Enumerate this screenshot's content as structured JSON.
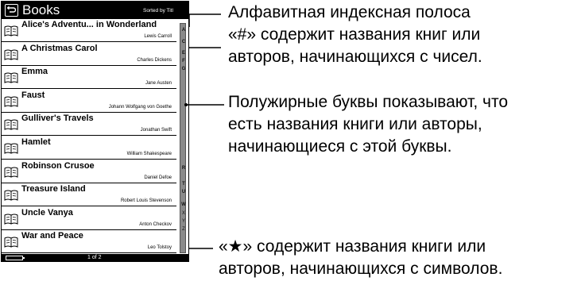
{
  "screen": {
    "header": {
      "title": "Books",
      "sort_label": "Sorted by Titl",
      "back_icon": "back-arrow-icon"
    },
    "books": [
      {
        "title": "Alice's Adventu... in Wonderland",
        "author": "Lewis Carroll"
      },
      {
        "title": "A Christmas Carol",
        "author": "Charles Dickens"
      },
      {
        "title": "Emma",
        "author": "Jane Austen"
      },
      {
        "title": "Faust",
        "author": "Johann Wolfgang von Goethe"
      },
      {
        "title": "Gulliver's Travels",
        "author": "Jonathan Swift"
      },
      {
        "title": "Hamlet",
        "author": "William Shakespeare"
      },
      {
        "title": "Robinson Crusoe",
        "author": "Daniel Defoe"
      },
      {
        "title": "Treasure Island",
        "author": "Robert Louis Stevenson"
      },
      {
        "title": "Uncle Vanya",
        "author": "Anton Checkov"
      },
      {
        "title": "War and Peace",
        "author": "Leo Tolstoy"
      }
    ],
    "alpha_index": [
      {
        "letter": "A",
        "bold": true
      },
      {
        "letter": "C",
        "bold": true
      },
      {
        "letter": "E",
        "bold": true
      },
      {
        "letter": "F",
        "bold": true
      },
      {
        "letter": "G",
        "bold": true
      },
      {
        "letter": "R",
        "bold": true
      },
      {
        "letter": "T",
        "bold": true
      },
      {
        "letter": "U",
        "bold": true
      },
      {
        "letter": "W",
        "bold": true
      },
      {
        "letter": "X",
        "bold": false
      },
      {
        "letter": "Y",
        "bold": false
      },
      {
        "letter": "Z",
        "bold": false
      }
    ],
    "footer": {
      "page": "1 of 2"
    }
  },
  "callouts": {
    "alpha_bar_title": "Алфавитная индексная полоса",
    "hash_line1": "«#» содержит названия книг или",
    "hash_line2": "авторов, начинающихся с чисел.",
    "bold_line1": "Полужирные буквы показывают, что",
    "bold_line2": "есть названия книги или авторы,",
    "bold_line3": "начинающиеся с этой буквы.",
    "star_line1": "«★» содержит названия книги или",
    "star_line2": "авторов, начинающихся с символов."
  }
}
